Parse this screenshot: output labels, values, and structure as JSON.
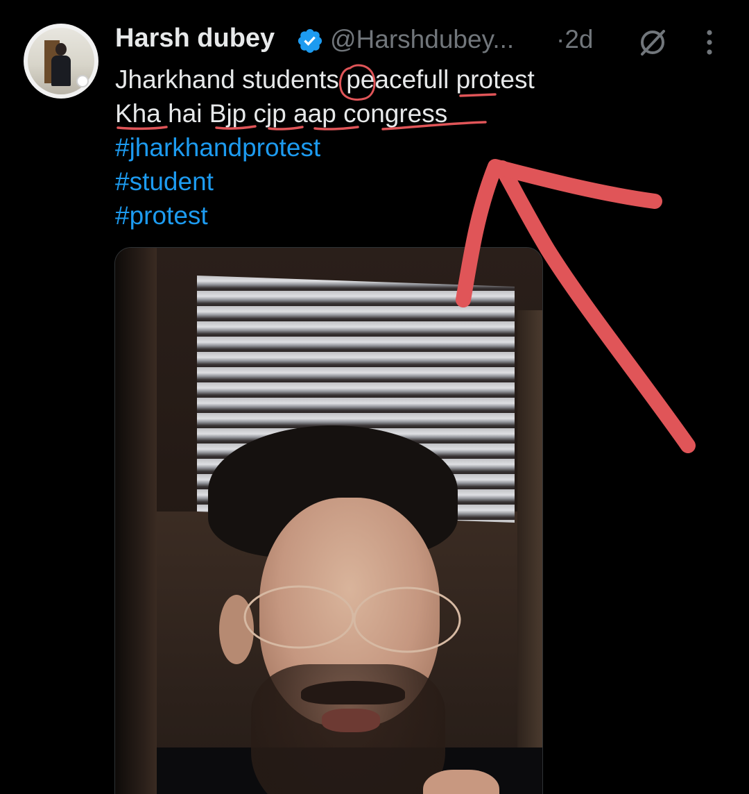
{
  "tweet": {
    "author_name": "Harsh dubey",
    "handle": "@Harshdubey...",
    "separator": "·",
    "time": "2d",
    "lines": [
      "Jharkhand students peacefull protest",
      "Kha hai Bjp cjp aap congress"
    ],
    "hashtags": [
      "#jharkhandprotest",
      "#student",
      "#protest"
    ]
  },
  "icons": {
    "verified": "verified-badge-icon",
    "grok": "grok-icon",
    "more": "more-vertical-icon"
  },
  "colors": {
    "background": "#000000",
    "text": "#e7e9ea",
    "muted": "#71767b",
    "link": "#1d9bf0",
    "annotation": "#e05558"
  }
}
